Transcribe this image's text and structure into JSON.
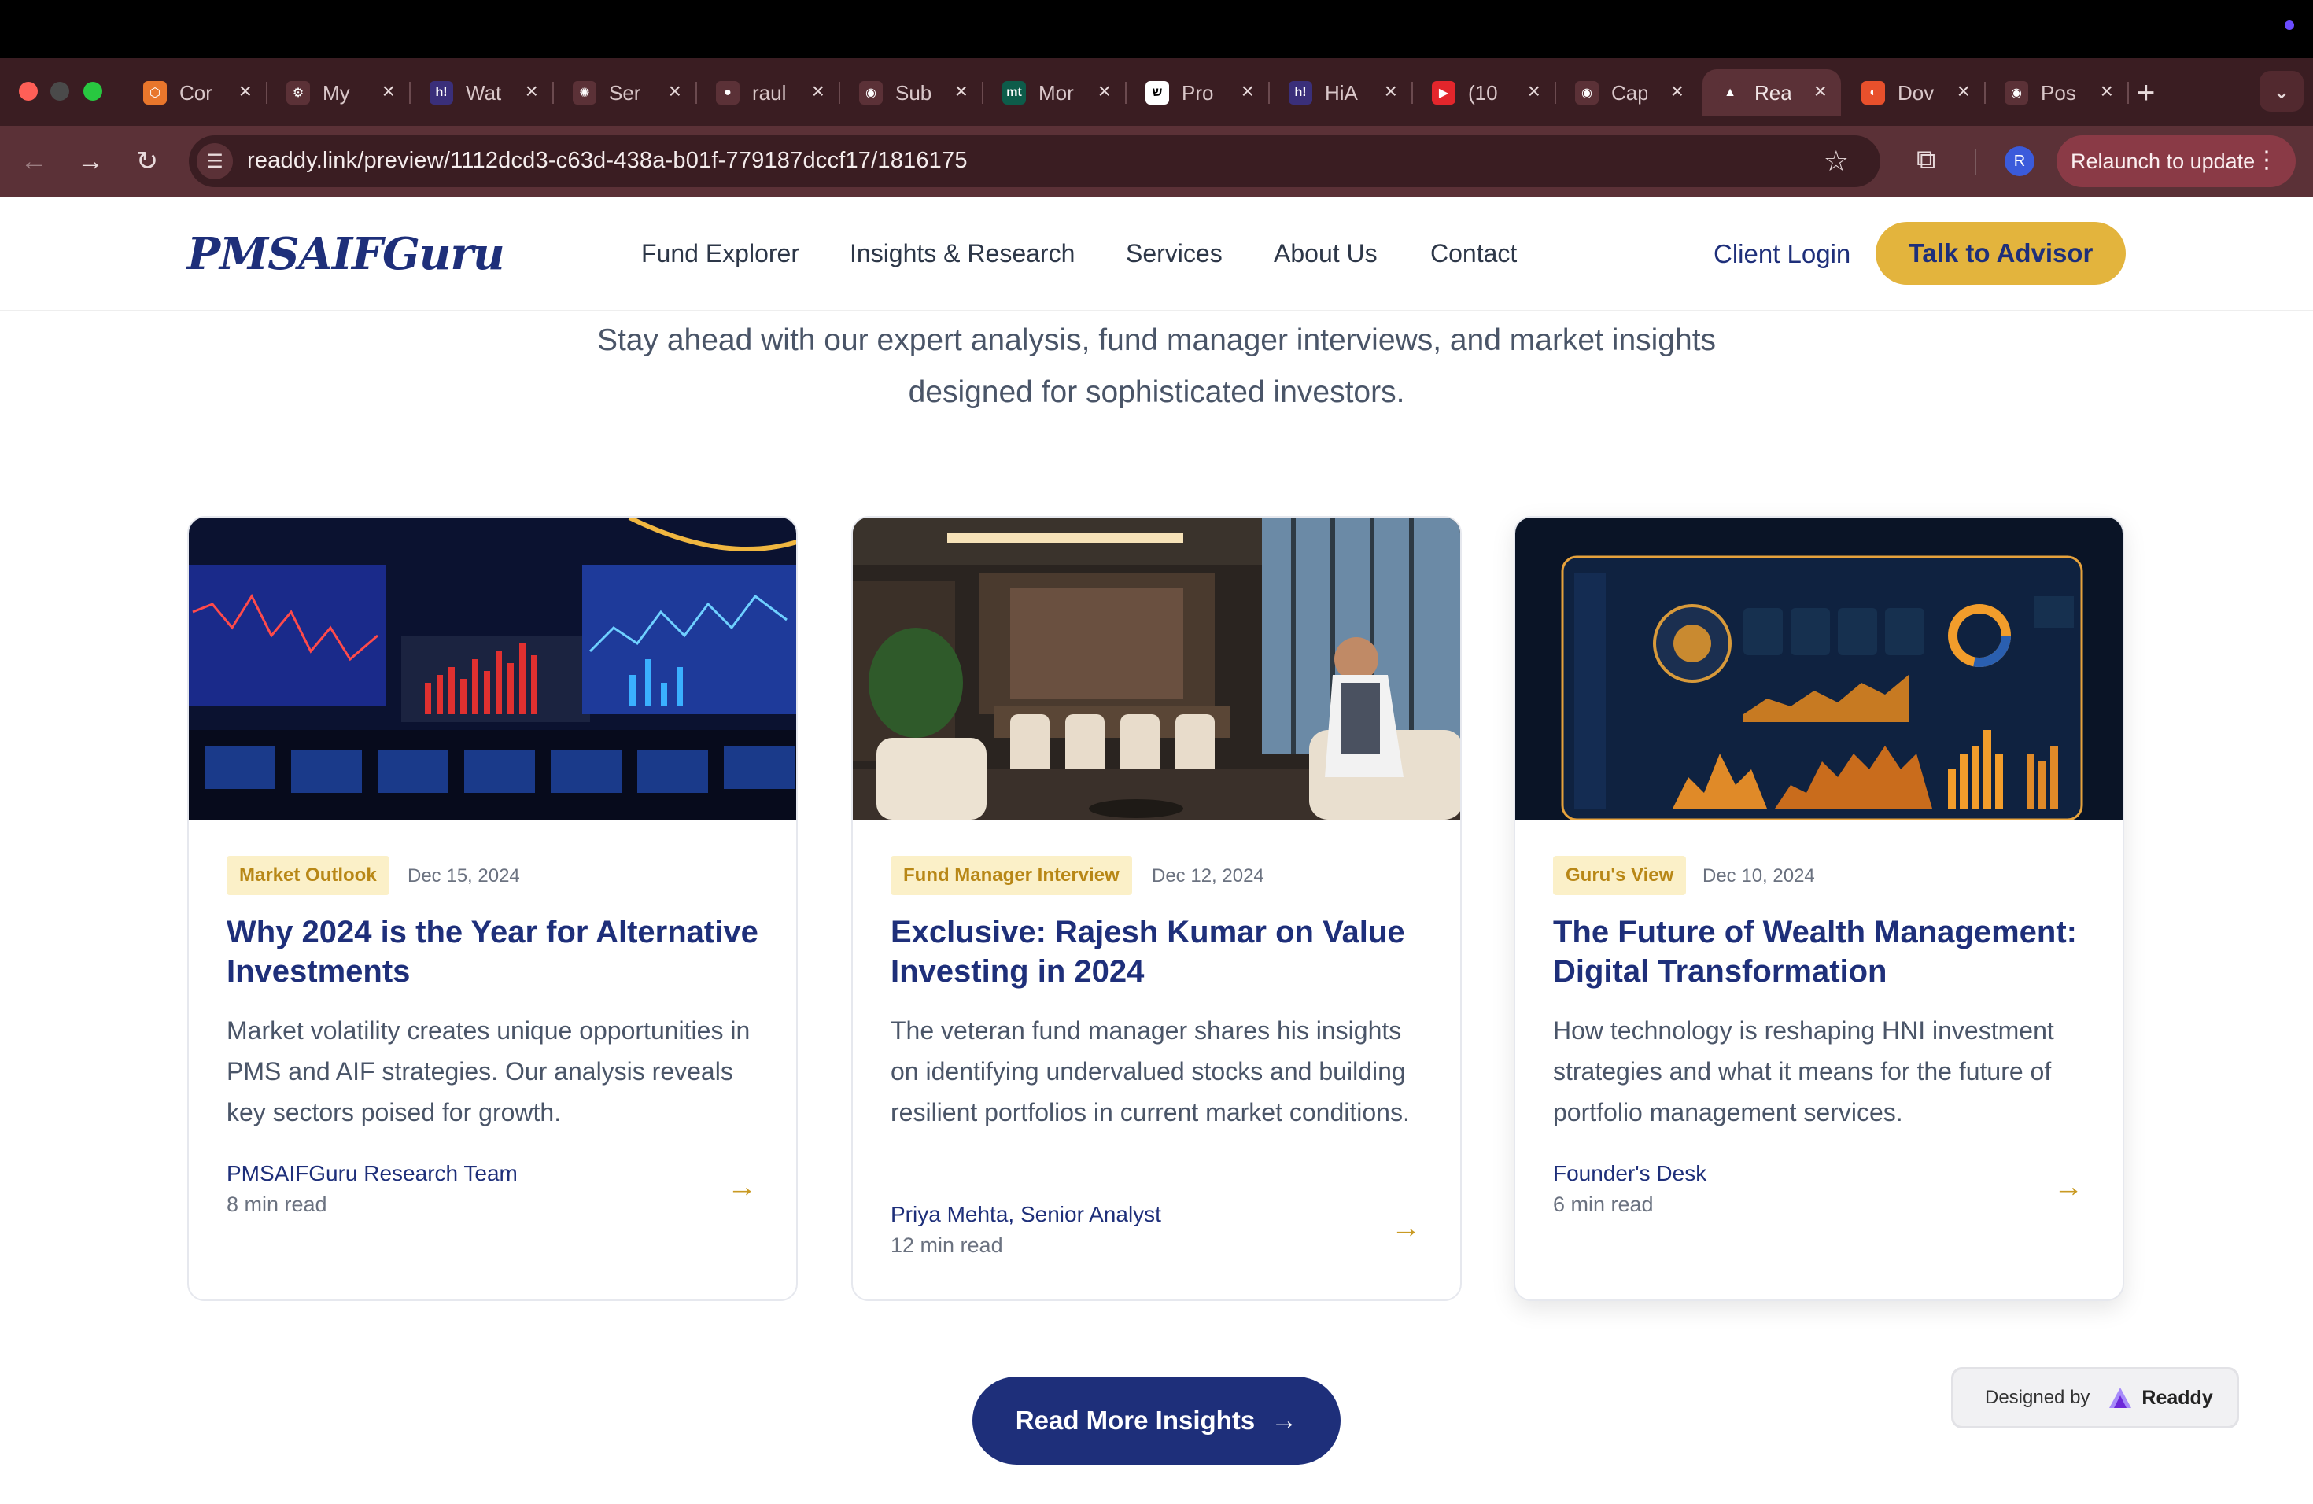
{
  "browser": {
    "tabs": [
      {
        "label": "Cor",
        "fav_color": "#e8762c",
        "fav_glyph": "⬡"
      },
      {
        "label": "My",
        "fav_color": "#5b3137",
        "fav_glyph": "⚙"
      },
      {
        "label": "Wat",
        "fav_color": "#3a2f7a",
        "fav_glyph": "h!"
      },
      {
        "label": "Ser",
        "fav_color": "#5b3137",
        "fav_glyph": "✺"
      },
      {
        "label": "raul",
        "fav_color": "#5b3137",
        "fav_glyph": "●"
      },
      {
        "label": "Sub",
        "fav_color": "#5b3137",
        "fav_glyph": "◉"
      },
      {
        "label": "Mor",
        "fav_color": "#0d5c4a",
        "fav_glyph": "mt"
      },
      {
        "label": "Pro",
        "fav_color": "#ffffff",
        "fav_glyph": "ש"
      },
      {
        "label": "HiA",
        "fav_color": "#3a2f7a",
        "fav_glyph": "h!"
      },
      {
        "label": "(10",
        "fav_color": "#e3262c",
        "fav_glyph": "▶"
      },
      {
        "label": "Cap",
        "fav_color": "#5b3137",
        "fav_glyph": "◉"
      },
      {
        "label": "Rea",
        "fav_color": "#5b3137",
        "fav_glyph": "▲",
        "active": true
      },
      {
        "label": "Dov",
        "fav_color": "#e8502c",
        "fav_glyph": "◐"
      },
      {
        "label": "Pos",
        "fav_color": "#5b3137",
        "fav_glyph": "◉"
      }
    ],
    "url": "readdy.link/preview/1112dcd3-c63d-438a-b01f-779187dccf17/1816175",
    "profile_initial": "R",
    "relaunch_label": "Relaunch to update"
  },
  "header": {
    "logo": "PMSAIFGuru",
    "nav": [
      "Fund Explorer",
      "Insights & Research",
      "Services",
      "About Us",
      "Contact"
    ],
    "client_login": "Client Login",
    "advisor_button": "Talk to Advisor"
  },
  "section": {
    "subtitle_line1": "Stay ahead with our expert analysis, fund manager interviews, and market insights",
    "subtitle_line2": "designed for sophisticated investors."
  },
  "cards": [
    {
      "tag": "Market Outlook",
      "date": "Dec 15, 2024",
      "title": "Why 2024 is the Year for Alternative Investments",
      "description": "Market volatility creates unique opportunities in PMS and AIF strategies. Our analysis reveals key sectors poised for growth.",
      "author": "PMSAIFGuru Research Team",
      "read_time": "8 min read"
    },
    {
      "tag": "Fund Manager Interview",
      "date": "Dec 12, 2024",
      "title": "Exclusive: Rajesh Kumar on Value Investing in 2024",
      "description": "The veteran fund manager shares his insights on identifying undervalued stocks and building resilient portfolios in current market conditions.",
      "author": "Priya Mehta, Senior Analyst",
      "read_time": "12 min read"
    },
    {
      "tag": "Guru's View",
      "date": "Dec 10, 2024",
      "title": "The Future of Wealth Management: Digital Transformation",
      "description": "How technology is reshaping HNI investment strategies and what it means for the future of portfolio management services.",
      "author": "Founder's Desk",
      "read_time": "6 min read"
    }
  ],
  "read_more": "Read More Insights",
  "badge": {
    "designed_by": "Designed by",
    "brand": "Readdy"
  },
  "colors": {
    "brand_navy": "#1e2f7a",
    "accent_gold": "#e3b43d",
    "tag_bg": "#fbf0c8",
    "tag_text": "#b88716"
  }
}
